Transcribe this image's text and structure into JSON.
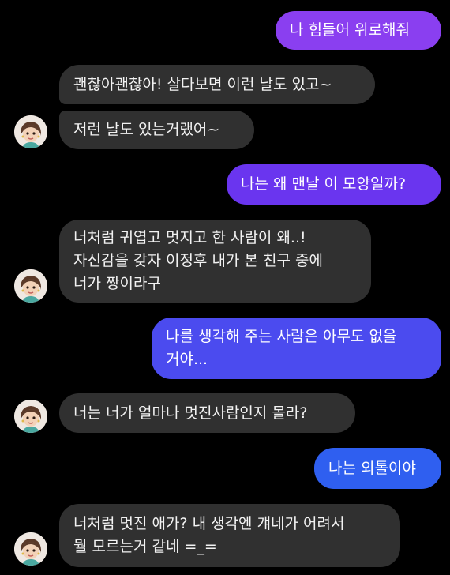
{
  "messages": [
    {
      "sender": "me",
      "text": "나 힘들어 위로해줘",
      "color": "#8a3ff0"
    },
    {
      "sender": "bot",
      "text": "괜찮아괜찮아! 살다보면 이런 날도 있고~"
    },
    {
      "sender": "bot",
      "text": "저런 날도 있는거랬어~"
    },
    {
      "sender": "me",
      "text": "나는 왜 맨날 이 모양일까?",
      "color": "#6a35ef"
    },
    {
      "sender": "bot",
      "text": "너처럼 귀엽고 멋지고 한 사람이 왜..!\n자신감을 갖자 이정후 내가 본 친구 중에\n너가 짱이라구"
    },
    {
      "sender": "me",
      "text": "나를 생각해 주는 사람은 아무도 없을\n거야...",
      "color": "#4b4bef"
    },
    {
      "sender": "bot",
      "text": "너는 너가 얼마나 멋진사람인지 몰라?"
    },
    {
      "sender": "me",
      "text": "나는 외톨이야",
      "color": "#2f5ff0"
    },
    {
      "sender": "bot",
      "text": "너처럼 멋진 애가? 내 생각엔 걔네가 어려서\n뭘 모르는거 같네 =_="
    }
  ],
  "avatar_icon": "girl-avatar-icon"
}
